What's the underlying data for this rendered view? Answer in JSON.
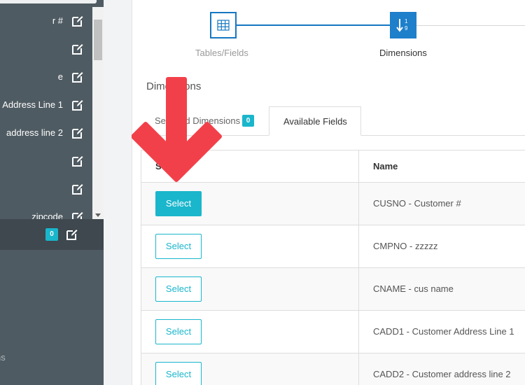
{
  "sidebar": {
    "items": [
      {
        "label": "r #"
      },
      {
        "label": ""
      },
      {
        "label": "e"
      },
      {
        "label": "Address Line 1"
      },
      {
        "label": "address line 2"
      },
      {
        "label": ""
      },
      {
        "label": ""
      },
      {
        "label": "zipcode"
      }
    ],
    "section_badge": "0",
    "lower_items": [
      "s",
      "ns"
    ]
  },
  "stepper": {
    "steps": [
      {
        "label": "Tables/Fields",
        "icon": "table-icon",
        "state": "completed"
      },
      {
        "label": "Dimensions",
        "icon": "sort-numeric-icon",
        "state": "active"
      }
    ]
  },
  "section": {
    "title": "Dimensions"
  },
  "tabs": [
    {
      "label": "Selected Dimensions",
      "badge": "0"
    },
    {
      "label": "Available Fields"
    }
  ],
  "table": {
    "headers": {
      "select": "Select",
      "name": "Name"
    },
    "rows": [
      {
        "button": "Select",
        "name": "CUSNO - Customer #",
        "active": true
      },
      {
        "button": "Select",
        "name": "CMPNO - zzzzz",
        "active": false
      },
      {
        "button": "Select",
        "name": "CNAME - cus name",
        "active": false
      },
      {
        "button": "Select",
        "name": "CADD1 - Customer Address Line 1",
        "active": false
      },
      {
        "button": "Select",
        "name": "CADD2 - Customer address line 2",
        "active": false
      }
    ]
  },
  "colors": {
    "accent": "#1ab6cc",
    "step_blue": "#1e7fcb",
    "sidebar_bg": "#4f5b62",
    "annotation_arrow": "#f2404a"
  }
}
